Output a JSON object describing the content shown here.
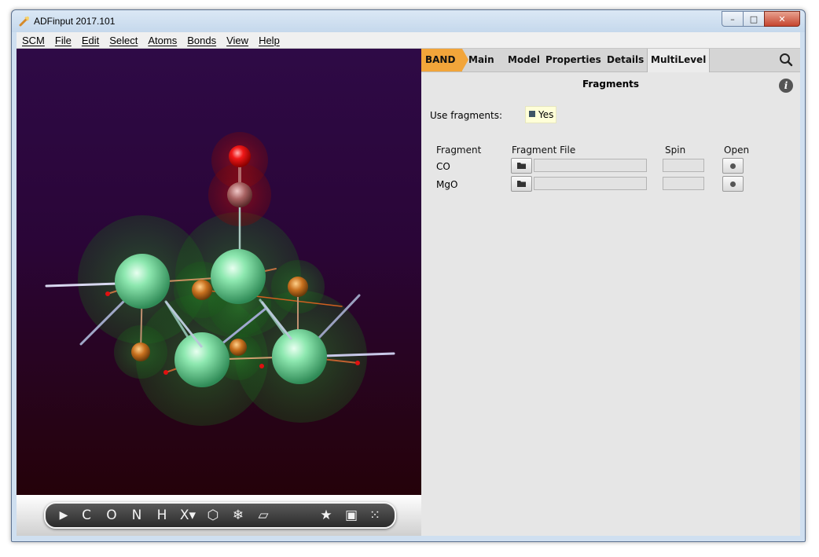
{
  "window": {
    "title": "ADFinput 2017.101",
    "minimize": "–",
    "maximize": "□",
    "close": "✕"
  },
  "menubar": {
    "items": [
      "SCM",
      "File",
      "Edit",
      "Select",
      "Atoms",
      "Bonds",
      "View",
      "Help"
    ]
  },
  "toolbar": {
    "tools": [
      {
        "label": "▶",
        "icon": "select-arrow-icon"
      },
      {
        "label": "C",
        "icon": "carbon-atom-tool"
      },
      {
        "label": "O",
        "icon": "oxygen-atom-tool"
      },
      {
        "label": "N",
        "icon": "nitrogen-atom-tool"
      },
      {
        "label": "H",
        "icon": "hydrogen-atom-tool"
      },
      {
        "label": "X▾",
        "icon": "other-element-tool"
      },
      {
        "label": "⬡",
        "icon": "hexagon-ring-icon"
      },
      {
        "label": "❄",
        "icon": "snowflake-icon"
      },
      {
        "label": "▱",
        "icon": "plane-icon"
      },
      {
        "label": "★",
        "icon": "star-icon"
      },
      {
        "label": "▣",
        "icon": "cube-frame-icon"
      },
      {
        "label": "⁙",
        "icon": "dots-grid-icon"
      }
    ]
  },
  "panel": {
    "tabs": [
      "BAND",
      "Main",
      "Model",
      "Properties",
      "Details",
      "MultiLevel"
    ],
    "active_tab": "MultiLevel",
    "section_title": "Fragments",
    "use_fragments_label": "Use fragments:",
    "use_fragments_value": "Yes",
    "columns": [
      "Fragment",
      "Fragment File",
      "Spin",
      "Open"
    ],
    "rows": [
      {
        "fragment": "CO",
        "file": "",
        "spin": ""
      },
      {
        "fragment": "MgO",
        "file": "",
        "spin": ""
      }
    ]
  },
  "colors": {
    "band_tab": "#f2a53a",
    "panel_bg": "#e6e6e6",
    "viewer_top": "#2e0a46",
    "viewer_bottom": "#240003",
    "mg_atom": "#8ee8b0",
    "o_atom": "#e02020",
    "c_atom": "#b06a6a"
  }
}
